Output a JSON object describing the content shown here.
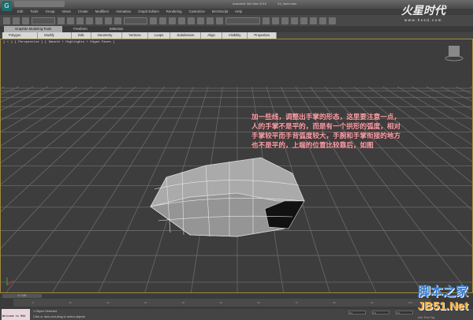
{
  "app": {
    "title": "Autodesk 3ds Max 2010",
    "file": "03_hand.max"
  },
  "menu": [
    "Edit",
    "Tools",
    "Group",
    "Views",
    "Create",
    "Modifiers",
    "Animation",
    "Graph Editors",
    "Rendering",
    "Customize",
    "MAXScript",
    "Help"
  ],
  "brand": {
    "name": "火星时代",
    "url": "www.hxsd.com"
  },
  "ribbon_tabs": [
    "Graphite Modeling Tools",
    "Freeform",
    "Selection"
  ],
  "ribbon_panels": [
    "Polygon Modeling",
    "Modify Selection",
    "Edit",
    "Geometry (All)",
    "Vertices",
    "Loops",
    "Subdivision",
    "Align",
    "Visibility",
    "Properties"
  ],
  "viewport": {
    "label": "[ + ] [ Perspective ] [ Smooth + Highlights + Edged Faces ]"
  },
  "note": [
    "加一些线，调整出手掌的形态，这里要注意一点，",
    "人的手掌不是平的，而是有一个拱形的弧度，相对",
    "手掌较平而手背弧度较大，手腕和手掌衔接的地方",
    "也不是平的，上端的位置比较靠后，如图"
  ],
  "timeline": {
    "frame": "0 / 100",
    "ticks": [
      "0",
      "10",
      "20",
      "30",
      "40",
      "50",
      "60",
      "70",
      "80",
      "90",
      "100"
    ]
  },
  "status": {
    "welcome": "Welcome to MAX",
    "selected": "1 Object Selected",
    "prompt": "Click or click-and-drag to select objects",
    "x": "0.0",
    "y": "0.0",
    "z": "0.0",
    "add_time_tag": "Add Time Tag"
  },
  "watermark": {
    "line1": "脚本之家",
    "line2": "JB51.Net"
  }
}
